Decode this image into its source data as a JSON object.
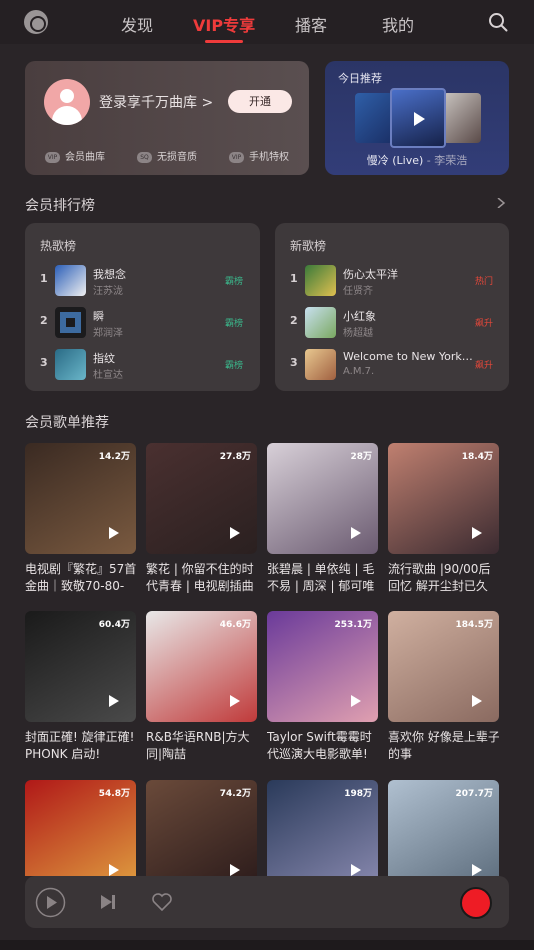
{
  "nav": {
    "tabs": [
      "发现",
      "VIP专享",
      "播客",
      "我的"
    ],
    "active_tab": "VIP专享",
    "accent_color": "#ef3b3b"
  },
  "login_card": {
    "prompt": "登录享千万曲库 >",
    "open_button": "开通",
    "perks": [
      {
        "icon": "vip-badge-icon",
        "label": "会员曲库"
      },
      {
        "icon": "sq-badge-icon",
        "label": "无损音质"
      },
      {
        "icon": "vip-badge-icon",
        "label": "手机特权"
      }
    ]
  },
  "today": {
    "title": "今日推荐",
    "song": "慢冷 (Live)",
    "artist": "- 李荣浩"
  },
  "rankings": {
    "section_title": "会员排行榜",
    "hot": {
      "title": "热歌榜",
      "rows": [
        {
          "num": "1",
          "song": "我想念",
          "artist": "汪苏泷",
          "tag": "霸榜"
        },
        {
          "num": "2",
          "song": "瞬",
          "artist": "郑润泽",
          "tag": "霸榜"
        },
        {
          "num": "3",
          "song": "指纹",
          "artist": "杜宣达",
          "tag": "霸榜"
        }
      ]
    },
    "new": {
      "title": "新歌榜",
      "rows": [
        {
          "num": "1",
          "song": "伤心太平洋",
          "artist": "任贤齐",
          "tag": "热门"
        },
        {
          "num": "2",
          "song": "小红象",
          "artist": "杨超越",
          "tag": "飙升"
        },
        {
          "num": "3",
          "song": "Welcome to New York (...",
          "artist": "A.M.7.",
          "tag": "飙升"
        }
      ]
    }
  },
  "playlists": {
    "section_title": "会员歌单推荐",
    "items": [
      {
        "count": "14.2万",
        "title": "电视剧『繁花』57首金曲｜致敬70-80-9..."
      },
      {
        "count": "27.8万",
        "title": "繁花 | 你留不住的时代青春 | 电视剧插曲"
      },
      {
        "count": "28万",
        "title": "张碧晨 | 单依纯 | 毛不易 | 周深 | 郁可唯"
      },
      {
        "count": "18.4万",
        "title": "流行歌曲 |90/00后回忆 解开尘封已久的..."
      },
      {
        "count": "60.4万",
        "title": "封面正確! 旋律正確! PHONK 启动!"
      },
      {
        "count": "46.6万",
        "title": "R&B华语RNB|方大同|陶喆"
      },
      {
        "count": "253.1万",
        "title": "Taylor Swift霉霉时代巡演大电影歌单!"
      },
      {
        "count": "184.5万",
        "title": "喜欢你 好像是上辈子的事"
      },
      {
        "count": "54.8万",
        "title": ""
      },
      {
        "count": "74.2万",
        "title": ""
      },
      {
        "count": "198万",
        "title": ""
      },
      {
        "count": "207.7万",
        "title": ""
      }
    ]
  },
  "player": {
    "controls": [
      "play-icon",
      "next-icon",
      "heart-icon"
    ],
    "record_color": "#ee1c25"
  }
}
